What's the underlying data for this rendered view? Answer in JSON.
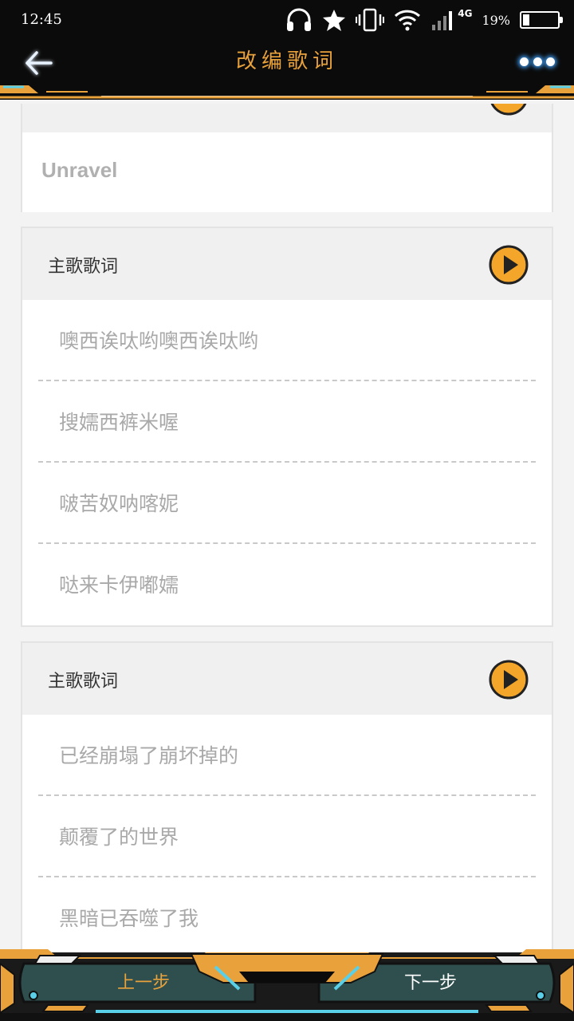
{
  "status_bar": {
    "time": "12:45",
    "network": "4G",
    "battery_percent": "19%",
    "battery_level": 0.19,
    "icons": [
      "headphones-icon",
      "star-icon",
      "vibrate-icon",
      "wifi-icon",
      "signal-icon",
      "battery-icon"
    ]
  },
  "header": {
    "title": "改编歌词",
    "back_icon": "arrow-left-icon",
    "more_icon": "more-dots-icon"
  },
  "song": {
    "name": "Unravel"
  },
  "sections": [
    {
      "title": "主歌歌词",
      "lines": [
        "噢西诶呔哟噢西诶呔哟",
        "搜嬬西裤米喔",
        "啵苦奴呐喀妮",
        "哒来卡伊嘟嬬"
      ]
    },
    {
      "title": "主歌歌词",
      "lines": [
        "已经崩塌了崩坏掉的",
        "颠覆了的世界",
        "黑暗已吞噬了我"
      ]
    }
  ],
  "footer": {
    "prev_label": "上一步",
    "next_label": "下一步"
  },
  "colors": {
    "accent": "#e9a23b",
    "play_fill": "#f4a62a",
    "header_bg": "#0b0b0b",
    "glow": "#3fa3ff",
    "footer_teal": "#2f4f4f"
  }
}
